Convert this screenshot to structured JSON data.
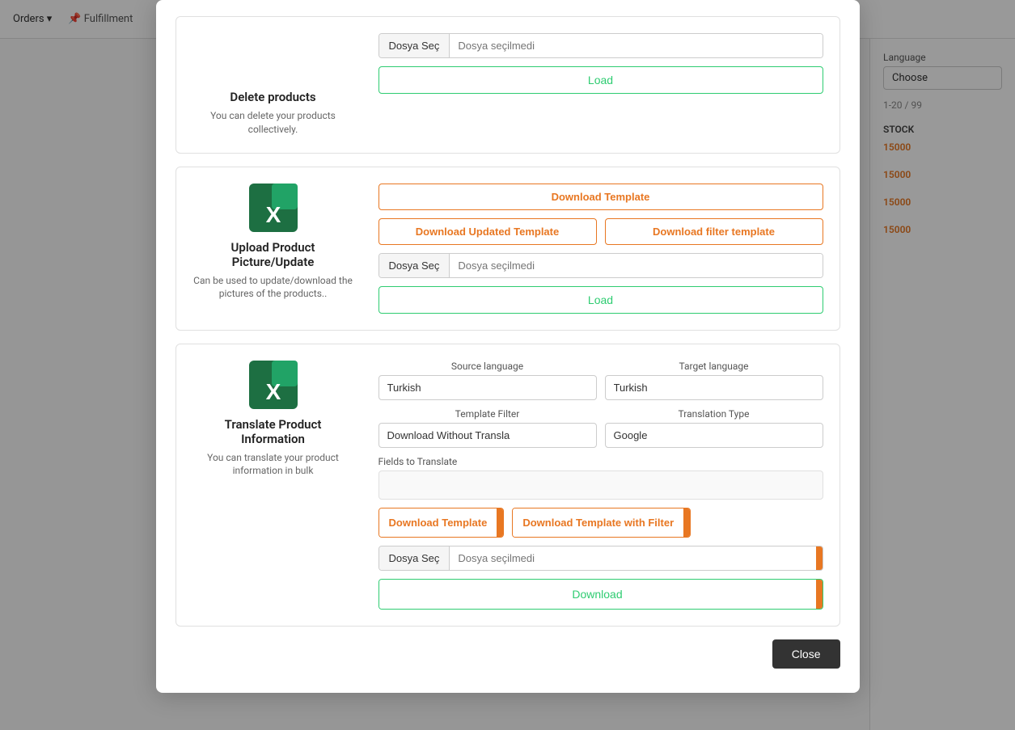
{
  "background": {
    "nav": {
      "items": [
        "Orders",
        "Fulfillment"
      ]
    },
    "right_panel": {
      "language_label": "Language",
      "language_placeholder": "Choose"
    },
    "table": {
      "stock_col": "STOCK",
      "pagination": "1-20 / 99",
      "rows": [
        {
          "stock": "15000"
        },
        {
          "stock": "15000"
        },
        {
          "stock": "15000"
        },
        {
          "stock": "15000"
        }
      ]
    }
  },
  "modal": {
    "sections": [
      {
        "id": "delete-products",
        "title": "Delete products",
        "desc": "You can delete your products collectively.",
        "has_icon": false,
        "file_choose_label": "Dosya Seç",
        "file_placeholder": "Dosya seçilmedi",
        "load_label": "Load",
        "buttons": []
      },
      {
        "id": "upload-picture",
        "title": "Upload Product Picture/Update",
        "desc": "Can be used to update/download the pictures of the products..",
        "has_icon": true,
        "file_choose_label": "Dosya Seç",
        "file_placeholder": "Dosya seçilmedi",
        "load_label": "Load",
        "buttons": [
          {
            "label": "Download Template",
            "type": "single"
          },
          {
            "label": "Download Updated Template",
            "type": "left"
          },
          {
            "label": "Download filter template",
            "type": "right"
          }
        ]
      },
      {
        "id": "translate-product",
        "title": "Translate Product Information",
        "desc": "You can translate your product information in bulk",
        "has_icon": true,
        "source_language_label": "Source language",
        "source_language_value": "Turkish",
        "target_language_label": "Target language",
        "target_language_value": "Turkish",
        "template_filter_label": "Template Filter",
        "template_filter_value": "Download Without Transla",
        "translation_type_label": "Translation Type",
        "translation_type_value": "Google",
        "fields_label": "Fields to Translate",
        "download_template_label": "Download Template",
        "download_template_with_filter_label": "Download Template with Filter",
        "file_choose_label": "Dosya Seç",
        "file_placeholder": "Dosya seçilmedi",
        "download_label": "Download"
      }
    ],
    "close_label": "Close"
  }
}
